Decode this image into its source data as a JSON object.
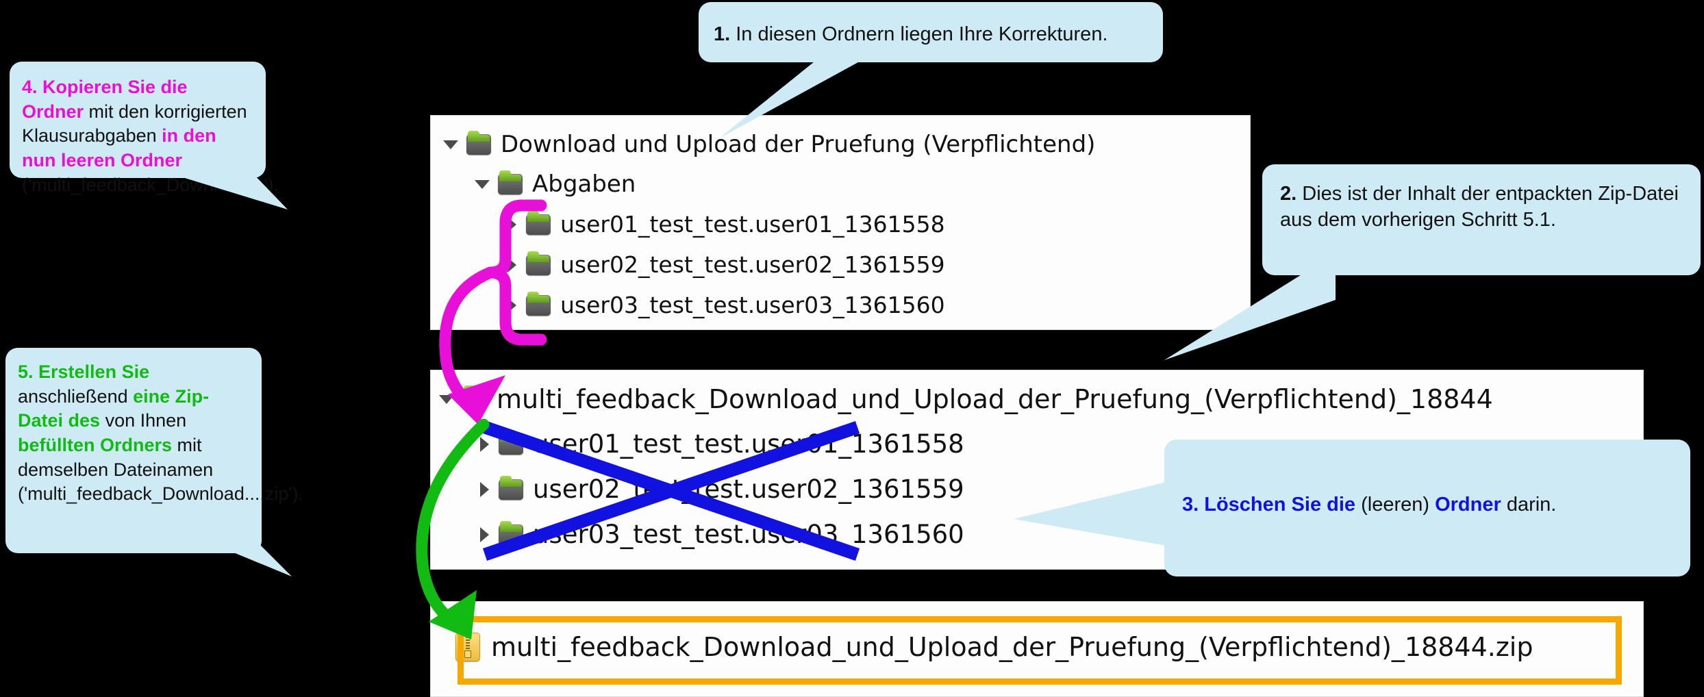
{
  "colors": {
    "background": "#000000",
    "panel": "#fdfdfd",
    "callout_fill": "#cdeaf5",
    "magenta": "#e810d8",
    "green": "#12bb12",
    "blue": "#1212e0",
    "zip_highlight": "#f5a800",
    "folder_green": "#8fc63d",
    "folder_grey": "#5a5a5a"
  },
  "tree_top": {
    "rows": [
      {
        "caret": "down",
        "icon": "folder-icon",
        "label": "Download und Upload der Pruefung (Verpflichtend)",
        "indent": 0
      },
      {
        "caret": "down",
        "icon": "folder-icon",
        "label": "Abgaben",
        "indent": 1
      },
      {
        "caret": "right",
        "icon": "folder-icon",
        "label": "user01_test_test.user01_1361558",
        "indent": 2
      },
      {
        "caret": "right",
        "icon": "folder-icon",
        "label": "user02_test_test.user02_1361559",
        "indent": 2
      },
      {
        "caret": "right",
        "icon": "folder-icon",
        "label": "user03_test_test.user03_1361560",
        "indent": 2
      }
    ]
  },
  "tree_mid": {
    "rows": [
      {
        "caret": "down",
        "icon": "folder-icon",
        "label": "multi_feedback_Download_und_Upload_der_Pruefung_(Verpflichtend)_18844",
        "indent": 0
      },
      {
        "caret": "right",
        "icon": "folder-icon",
        "label": "user01_test_test.user01_1361558",
        "indent": 1
      },
      {
        "caret": "right",
        "icon": "folder-icon",
        "label": "user02_test_test.user02_1361559",
        "indent": 1
      },
      {
        "caret": "right",
        "icon": "folder-icon",
        "label": "user03_test_test.user03_1361560",
        "indent": 1
      }
    ]
  },
  "tree_bottom": {
    "row": {
      "icon": "zip-file-icon",
      "label": "multi_feedback_Download_und_Upload_der_Pruefung_(Verpflichtend)_18844.zip"
    }
  },
  "callouts": {
    "one": {
      "id": "1",
      "number": "1.",
      "segments": [
        {
          "text": "1.",
          "style": "bold-black"
        },
        {
          "text": " In diesen Ordnern liegen Ihre Korrekturen.",
          "style": "normal"
        }
      ]
    },
    "two": {
      "id": "2",
      "number": "2.",
      "segments": [
        {
          "text": "2.",
          "style": "bold-black"
        },
        {
          "text": " Dies ist der Inhalt der entpackten Zip-Datei aus dem vorherigen Schritt 5.1.",
          "style": "normal"
        }
      ]
    },
    "three": {
      "id": "3",
      "number": "3.",
      "segments": [
        {
          "text": "3. Löschen Sie die",
          "style": "bold-blue"
        },
        {
          "text": " (leeren) ",
          "style": "normal"
        },
        {
          "text": "Ordner",
          "style": "bold-blue"
        },
        {
          "text": " darin.",
          "style": "normal"
        }
      ]
    },
    "four": {
      "id": "4",
      "number": "4.",
      "segments": [
        {
          "text": "4. Kopieren Sie die Ordner",
          "style": "bold-magenta"
        },
        {
          "text": " mit den korrigierten Klausurabgaben ",
          "style": "normal"
        },
        {
          "text": "in den nun leeren Ordner",
          "style": "bold-magenta"
        },
        {
          "text": " ('multi_feedback_Download...').",
          "style": "normal"
        }
      ]
    },
    "five": {
      "id": "5",
      "number": "5.",
      "segments": [
        {
          "text": "5. Erstellen Sie",
          "style": "bold-green"
        },
        {
          "text": " anschließend ",
          "style": "normal"
        },
        {
          "text": "eine Zip-Datei des",
          "style": "bold-green"
        },
        {
          "text": " von Ihnen ",
          "style": "normal"
        },
        {
          "text": "befüllten Ordners",
          "style": "bold-green"
        },
        {
          "text": " mit demselben Dateinamen ('multi_feedback_Download....zip').",
          "style": "normal"
        }
      ]
    }
  },
  "annotations": {
    "magenta_bracket": "magenta-bracket-and-arrow",
    "green_arrow": "green-curved-arrow",
    "blue_cross": "blue-strikethrough-cross",
    "orange_box": "orange-highlight-box"
  }
}
